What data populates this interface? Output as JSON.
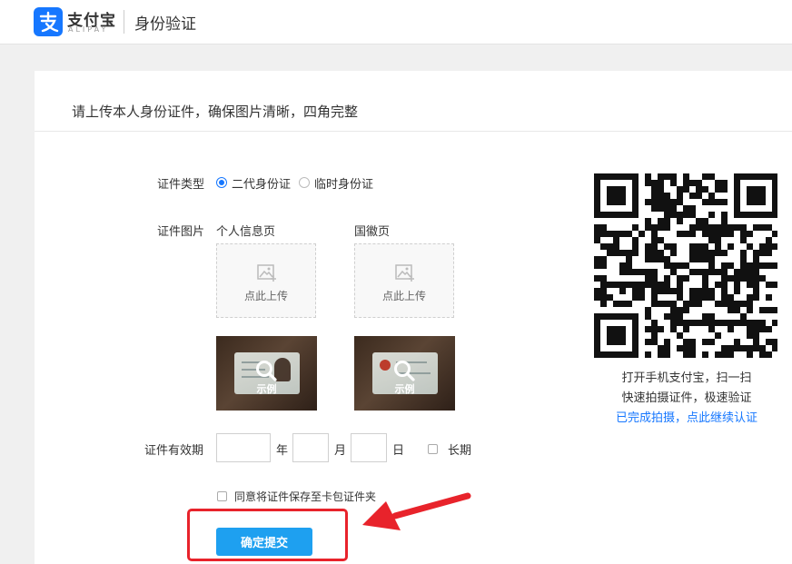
{
  "header": {
    "brand_cn": "支付宝",
    "brand_en": "ALIPAY",
    "title": "身份验证"
  },
  "instruction": "请上传本人身份证件，确保图片清晰，四角完整",
  "form": {
    "id_type_label": "证件类型",
    "id_type_options": [
      {
        "label": "二代身份证",
        "checked": true
      },
      {
        "label": "临时身份证",
        "checked": false
      }
    ],
    "id_image_label": "证件图片",
    "front_label": "个人信息页",
    "back_label": "国徽页",
    "upload_text": "点此上传",
    "sample_text": "示例",
    "validity_label": "证件有效期",
    "year_unit": "年",
    "month_unit": "月",
    "day_unit": "日",
    "long_term_label": "长期",
    "year_value": "",
    "month_value": "",
    "day_value": "",
    "save_to_wallet_label": "同意将证件保存至卡包证件夹",
    "submit_label": "确定提交"
  },
  "qr": {
    "line1": "打开手机支付宝，扫一扫",
    "line2": "快速拍摄证件，极速验证",
    "link": "已完成拍摄，点此继续认证"
  },
  "colors": {
    "brand_blue": "#1677ff",
    "button_blue": "#1ea0f0",
    "highlight_red": "#e8232b"
  },
  "icons": {
    "upload": "image-upload-icon",
    "sample": "search-icon",
    "annotation": "red-arrow"
  }
}
